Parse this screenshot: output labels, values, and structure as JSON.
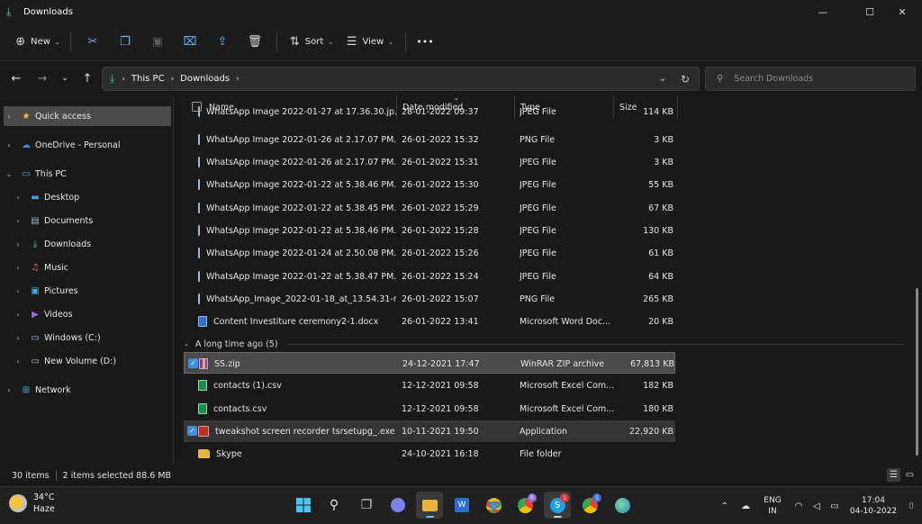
{
  "window": {
    "title": "Downloads"
  },
  "commands": {
    "new": "New",
    "sort": "Sort",
    "view": "View",
    "more": "•••"
  },
  "address": {
    "crumbs": [
      "This PC",
      "Downloads"
    ],
    "search_placeholder": "Search Downloads"
  },
  "sidebar": {
    "items": [
      {
        "label": "Quick access"
      },
      {
        "label": "OneDrive - Personal"
      },
      {
        "label": "This PC"
      },
      {
        "label": "Desktop"
      },
      {
        "label": "Documents"
      },
      {
        "label": "Downloads"
      },
      {
        "label": "Music"
      },
      {
        "label": "Pictures"
      },
      {
        "label": "Videos"
      },
      {
        "label": "Windows (C:)"
      },
      {
        "label": "New Volume (D:)"
      },
      {
        "label": "Network"
      }
    ]
  },
  "columns": {
    "name": "Name",
    "date": "Date modified",
    "type": "Type",
    "size": "Size"
  },
  "files": [
    {
      "name": "WhatsApp Image 2022-01-27 at 17.36.30.jp...",
      "date": "28-01-2022 09:37",
      "type": "JPEG File",
      "size": "114 KB"
    },
    {
      "name": "WhatsApp Image 2022-01-26 at 2.17.07 PM...",
      "date": "26-01-2022 15:32",
      "type": "PNG File",
      "size": "3 KB"
    },
    {
      "name": "WhatsApp Image 2022-01-26 at 2.17.07 PM...",
      "date": "26-01-2022 15:31",
      "type": "JPEG File",
      "size": "3 KB"
    },
    {
      "name": "WhatsApp Image 2022-01-22 at 5.38.46 PM...",
      "date": "26-01-2022 15:30",
      "type": "JPEG File",
      "size": "55 KB"
    },
    {
      "name": "WhatsApp Image 2022-01-22 at 5.38.45 PM...",
      "date": "26-01-2022 15:29",
      "type": "JPEG File",
      "size": "67 KB"
    },
    {
      "name": "WhatsApp Image 2022-01-22 at 5.38.46 PM...",
      "date": "26-01-2022 15:28",
      "type": "JPEG File",
      "size": "130 KB"
    },
    {
      "name": "WhatsApp Image 2022-01-24 at 2.50.08 PM...",
      "date": "26-01-2022 15:26",
      "type": "JPEG File",
      "size": "61 KB"
    },
    {
      "name": "WhatsApp Image 2022-01-22 at 5.38.47 PM...",
      "date": "26-01-2022 15:24",
      "type": "JPEG File",
      "size": "64 KB"
    },
    {
      "name": "WhatsApp_Image_2022-01-18_at_13.54.31-r...",
      "date": "26-01-2022 15:07",
      "type": "PNG File",
      "size": "265 KB"
    },
    {
      "name": "Content Investiture ceremony2-1.docx",
      "date": "26-01-2022 13:41",
      "type": "Microsoft Word Doc...",
      "size": "20 KB"
    }
  ],
  "group_old": {
    "label": "A long time ago (5)"
  },
  "old_files": [
    {
      "name": "SS.zip",
      "date": "24-12-2021 17:47",
      "type": "WinRAR ZIP archive",
      "size": "67,813 KB"
    },
    {
      "name": "contacts (1).csv",
      "date": "12-12-2021 09:58",
      "type": "Microsoft Excel Com...",
      "size": "182 KB"
    },
    {
      "name": "contacts.csv",
      "date": "12-12-2021 09:58",
      "type": "Microsoft Excel Com...",
      "size": "180 KB"
    },
    {
      "name": "tweakshot screen recorder tsrsetupg_.exe",
      "date": "10-11-2021 19:50",
      "type": "Application",
      "size": "22,920 KB"
    },
    {
      "name": "Skype",
      "date": "24-10-2021 16:18",
      "type": "File folder",
      "size": ""
    }
  ],
  "status": {
    "items": "30 items",
    "selected": "2 items selected  88.6 MB"
  },
  "taskbar": {
    "temp": "34°C",
    "condition": "Haze",
    "lang": "ENG",
    "region": "IN",
    "time": "17:04",
    "date": "04-10-2022",
    "skype_badge": "1",
    "chrome_badge_r": "R",
    "chrome_badge_s": "S"
  },
  "colors": {
    "accent": "#6ab7ff",
    "selection": "#4a4a4a",
    "downloads_teal": "#4fc3c3"
  }
}
